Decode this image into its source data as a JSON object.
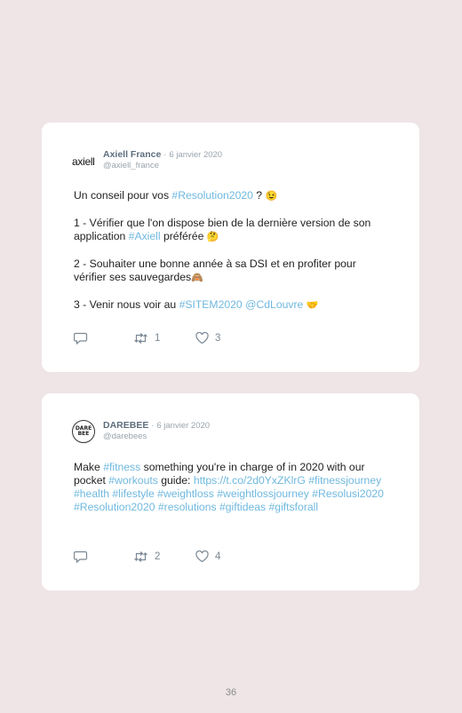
{
  "tweets": [
    {
      "avatar_text": "axiell",
      "author": "Axiell France",
      "sep": "·",
      "date": "6 janvier 2020",
      "handle": "@axiell_france",
      "body": {
        "p1_a": "Un conseil pour vos ",
        "p1_tag": "#Resolution2020",
        "p1_b": " ? ",
        "p1_emoji": "😉",
        "p2_a": "1 - Vérifier que l'on dispose bien de la dernière version de son application ",
        "p2_tag": "#Axiell",
        "p2_b": " préférée ",
        "p2_emoji": "🤔",
        "p3_a": "2 - Souhaiter une bonne année à sa DSI et en profiter pour vérifier ses sauvegardes",
        "p3_emoji": "🙈",
        "p4_a": "3 - Venir nous voir au ",
        "p4_tag1": "#SITEM2020",
        "p4_sp": " ",
        "p4_tag2": "@CdLouvre",
        "p4_sp2": " ",
        "p4_emoji": "🤝"
      },
      "retweets": "1",
      "likes": "3"
    },
    {
      "avatar_text": "DARE BEE",
      "author": "DAREBEE",
      "sep": "·",
      "date": "6 janvier 2020",
      "handle": "@darebees",
      "body": {
        "t1": "Make ",
        "tag_fitness": "#fitness",
        "t2": " something you're in charge of in 2020 with our pocket ",
        "tag_workouts": "#workouts",
        "t3": " guide: ",
        "url": "https://t.co/2d0YxZKlrG",
        "tags_rest": "#fitnessjourney #health #lifestyle #weightloss #weightlossjourney #Resolusi2020 #Resolution2020 #resolutions #giftideas #giftsforall"
      },
      "retweets": "2",
      "likes": "4"
    }
  ],
  "icons": {
    "reply": "reply-icon",
    "retweet": "retweet-icon",
    "like": "heart-icon"
  },
  "colors": {
    "background": "#efe5e6",
    "card": "#ffffff",
    "link": "#6fb8df",
    "muted": "#9aa4ad"
  },
  "page_number": "36"
}
